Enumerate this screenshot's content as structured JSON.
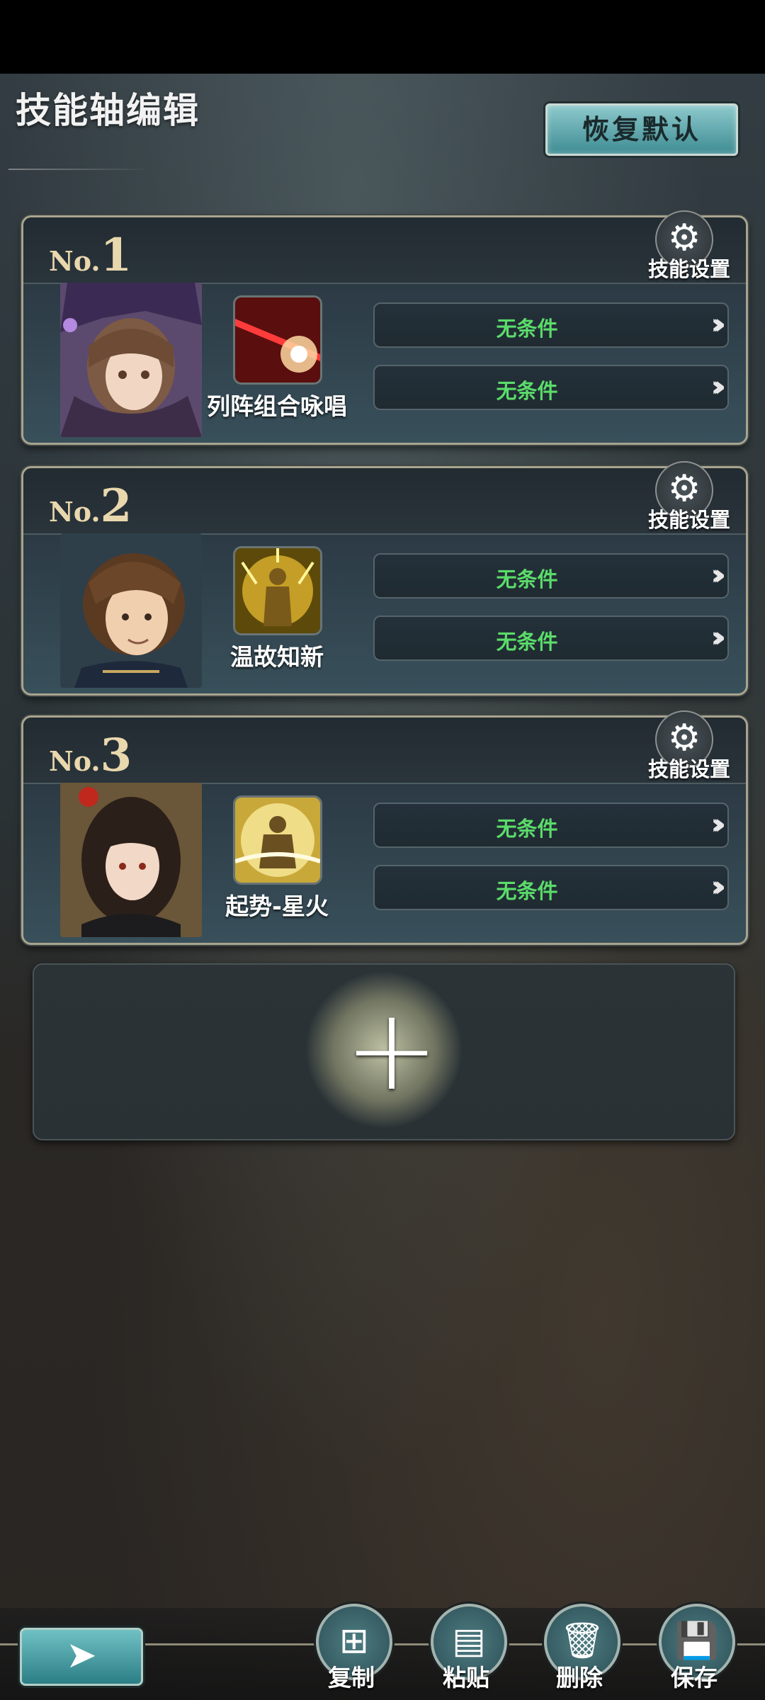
{
  "title": "技能轴编辑",
  "restore_button": "恢复默认",
  "cards": [
    {
      "no_prefix": "No.",
      "no_num": "1",
      "skill_name": "列阵组合咏唱",
      "gear_label": "技能设置",
      "conditions": [
        "无条件",
        "无条件"
      ]
    },
    {
      "no_prefix": "No.",
      "no_num": "2",
      "skill_name": "温故知新",
      "gear_label": "技能设置",
      "conditions": [
        "无条件",
        "无条件"
      ]
    },
    {
      "no_prefix": "No.",
      "no_num": "3",
      "skill_name": "起势-星火",
      "gear_label": "技能设置",
      "conditions": [
        "无条件",
        "无条件"
      ]
    }
  ],
  "add_symbol": "+",
  "toolbar": {
    "copy": "复制",
    "paste": "粘贴",
    "delete": "删除",
    "save": "保存"
  },
  "icons": {
    "gear": "gear-icon",
    "arrow": "triple-chevron-icon",
    "back": "back-arrow-icon"
  },
  "colors": {
    "condition_text": "#5bdc6a",
    "accent_teal": "#3e8c93",
    "number_gold": "#e9d7ad"
  }
}
